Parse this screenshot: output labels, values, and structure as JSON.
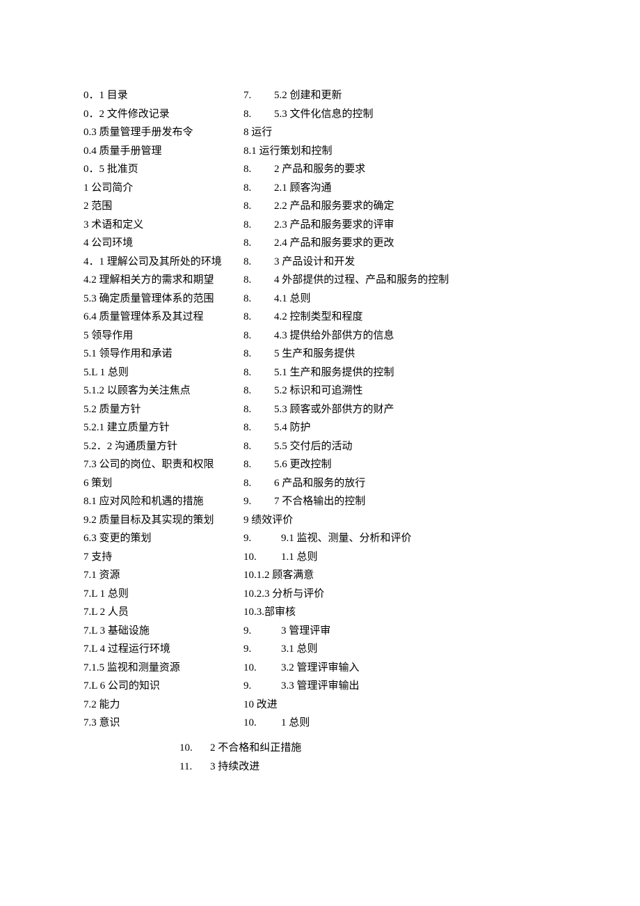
{
  "left": [
    "0．1 目录",
    "0．2 文件修改记录",
    "0.3 质量管理手册发布令",
    "0.4 质量手册管理",
    "0．5 批准页",
    "1 公司简介",
    "2 范围",
    "3 术语和定义",
    "4 公司环境",
    "4．1 理解公司及其所处的环境",
    "4.2 理解相关方的需求和期望",
    "5.3 确定质量管理体系的范围",
    "6.4 质量管理体系及其过程",
    "5 领导作用",
    "5.1 领导作用和承诺",
    "5.L 1 总则",
    "5.1.2 以顾客为关注焦点",
    "5.2 质量方针",
    "5.2.1 建立质量方针",
    "5.2．2 沟通质量方针",
    "7.3 公司的岗位、职责和权限",
    "6 策划",
    "8.1 应对风险和机遇的措施",
    "9.2 质量目标及其实现的策划",
    "6.3 变更的策划",
    "7 支持",
    "7.1 资源",
    "7.L 1 总则",
    "7.L 2 人员",
    "7.L 3 基础设施",
    "7.L 4 过程运行环境",
    "7.1.5 监视和测量资源",
    "7.L 6 公司的知识",
    "7.2 能力",
    "7.3 意识"
  ],
  "right": [
    {
      "p": "7.",
      "t": "5.2 创建和更新"
    },
    {
      "p": "8.",
      "t": "5.3 文件化信息的控制"
    },
    {
      "p": "",
      "t": "8 运行"
    },
    {
      "p": "",
      "t": "8.1 运行策划和控制"
    },
    {
      "p": "8.",
      "t": "2 产品和服务的要求"
    },
    {
      "p": "8.",
      "t": "2.1 顾客沟通"
    },
    {
      "p": "8.",
      "t": "2.2 产品和服务要求的确定"
    },
    {
      "p": "8.",
      "t": "2.3 产品和服务要求的评审"
    },
    {
      "p": "8.",
      "t": "2.4 产品和服务要求的更改"
    },
    {
      "p": "8.",
      "t": "3 产品设计和开发"
    },
    {
      "p": "8.",
      "t": "4 外部提供的过程、产品和服务的控制"
    },
    {
      "p": "8.",
      "t": "4.1 总则"
    },
    {
      "p": "8.",
      "t": "4.2 控制类型和程度"
    },
    {
      "p": "8.",
      "t": "4.3 提供给外部供方的信息"
    },
    {
      "p": "8.",
      "t": "5 生产和服务提供"
    },
    {
      "p": "8.",
      "t": "5.1 生产和服务提供的控制"
    },
    {
      "p": "8.",
      "t": "5.2 标识和可追溯性"
    },
    {
      "p": "8.",
      "t": "5.3 顾客或外部供方的财产"
    },
    {
      "p": "8.",
      "t": "5.4 防护"
    },
    {
      "p": "8.",
      "t": "5.5 交付后的活动"
    },
    {
      "p": "8.",
      "t": "5.6 更改控制"
    },
    {
      "p": "8.",
      "t": "6 产品和服务的放行"
    },
    {
      "p": "9.",
      "t": "7 不合格输出的控制"
    },
    {
      "p": "",
      "t": "9 绩效评价"
    },
    {
      "p": "9.",
      "t": "9.1 监视、测量、分析和评价",
      "w": true
    },
    {
      "p": "10.",
      "t": "1.1 总则",
      "w": true
    },
    {
      "p": "",
      "t": "10.1.2 顾客满意"
    },
    {
      "p": "",
      "t": "10.2.3 分析与评价"
    },
    {
      "p": "",
      "t": "10.3.部审核"
    },
    {
      "p": "9.",
      "t": "3 管理评审",
      "w": true
    },
    {
      "p": "9.",
      "t": "3.1 总则",
      "w": true
    },
    {
      "p": "10.",
      "t": "3.2 管理评审输入",
      "w": true
    },
    {
      "p": "9.",
      "t": "3.3 管理评审输出",
      "w": true
    },
    {
      "p": "",
      "t": "10 改进"
    },
    {
      "p": "10.",
      "t": "1 总则",
      "w": true
    }
  ],
  "bottom": [
    {
      "p": "10.",
      "t": "2 不合格和纠正措施"
    },
    {
      "p": "11.",
      "t": "3 持续改进"
    }
  ]
}
